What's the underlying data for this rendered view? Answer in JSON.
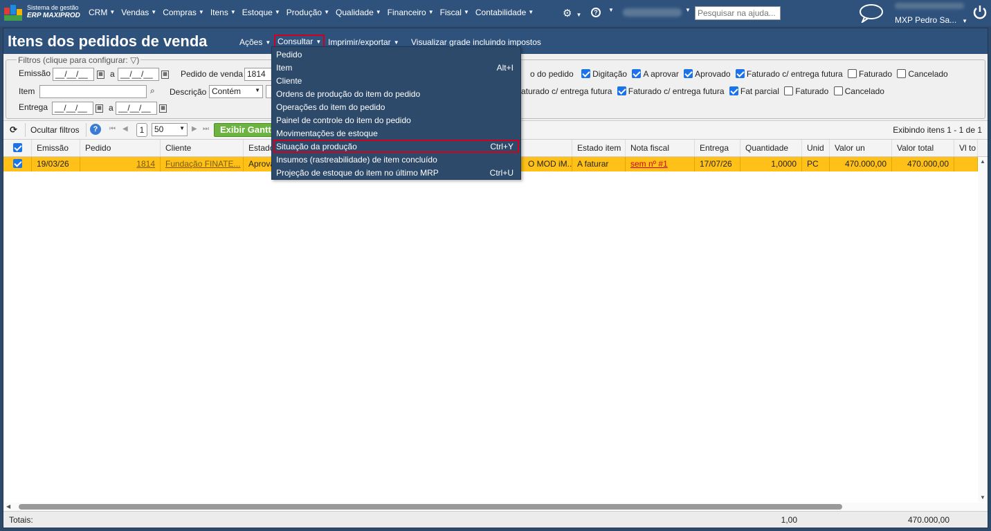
{
  "brand": {
    "line1": "Sistema de gestão",
    "line2": "ERP MAXIPROD"
  },
  "nav": [
    "CRM",
    "Vendas",
    "Compras",
    "Itens",
    "Estoque",
    "Produção",
    "Qualidade",
    "Financeiro",
    "Fiscal",
    "Contabilidade"
  ],
  "search": {
    "placeholder": "Pesquisar na ajuda..."
  },
  "user": {
    "name": "MXP Pedro Sa..."
  },
  "window": {
    "title": "Itens dos pedidos de venda",
    "menu": {
      "acoes": "Ações",
      "consultar": "Consultar",
      "imprimir": "Imprimir/exportar",
      "visualizar": "Visualizar grade incluindo impostos"
    }
  },
  "filters": {
    "legend": "Filtros (clique para configurar:",
    "legend_close": ")",
    "emissao_label": "Emissão",
    "date_placeholder": "__/__/__",
    "a_label": "a",
    "pedido_label": "Pedido de venda",
    "pedido_value": "1814",
    "item_label": "Item",
    "descricao_label": "Descrição",
    "descricao_value": "Contém",
    "entrega_label": "Entrega",
    "estado_pedido_label": "o do pedido",
    "estado_pedido": [
      {
        "label": "Digitação",
        "checked": true
      },
      {
        "label": "A aprovar",
        "checked": true
      },
      {
        "label": "Aprovado",
        "checked": true
      },
      {
        "label": "Faturado c/ entrega futura",
        "checked": true
      },
      {
        "label": "Faturado",
        "checked": false
      },
      {
        "label": "Cancelado",
        "checked": false
      }
    ],
    "estado_item_partial": "aturado c/ entrega futura",
    "estado_item": [
      {
        "label": "Faturado c/ entrega futura",
        "checked": true
      },
      {
        "label": "Fat parcial",
        "checked": true
      },
      {
        "label": "Faturado",
        "checked": false
      },
      {
        "label": "Cancelado",
        "checked": false
      }
    ]
  },
  "toolbar": {
    "ocultar": "Ocultar filtros",
    "page": "1",
    "page_size": "50",
    "gantt": "Exibir Gantt",
    "info": "Exibindo itens 1 - 1 de 1"
  },
  "grid": {
    "headers": [
      "Emissão",
      "Pedido",
      "Cliente",
      "Estado",
      "Estado item",
      "Nota fiscal",
      "Entrega",
      "Quantidade",
      "Unid",
      "Valor un",
      "Valor total",
      "Vl to"
    ],
    "row": {
      "emissao": "19/03/26",
      "pedido": "1814",
      "cliente": "Fundação FINATE...",
      "estado": "Aprova",
      "descricao": "O MOD iM...",
      "estado_item": "A faturar",
      "nota_fiscal": "sem nº #1",
      "entrega": "17/07/26",
      "quantidade": "1,0000",
      "unid": "PC",
      "valor_un": "470.000,00",
      "valor_total": "470.000,00"
    },
    "totals": {
      "label": "Totais:",
      "quantidade": "1,00",
      "valor_total": "470.000,00"
    }
  },
  "dropdown": [
    {
      "label": "Pedido",
      "shortcut": ""
    },
    {
      "label": "Item",
      "shortcut": "Alt+I"
    },
    {
      "label": "Cliente",
      "shortcut": ""
    },
    {
      "label": "Ordens de produção do item do pedido",
      "shortcut": ""
    },
    {
      "label": "Operações do item do pedido",
      "shortcut": ""
    },
    {
      "label": "Painel de controle do item do pedido",
      "shortcut": ""
    },
    {
      "label": "Movimentações de estoque",
      "shortcut": ""
    },
    {
      "label": "Situação da produção",
      "shortcut": "Ctrl+Y"
    },
    {
      "label": "Insumos (rastreabilidade) de item concluído",
      "shortcut": ""
    },
    {
      "label": "Projeção de estoque do item no último MRP",
      "shortcut": "Ctrl+U"
    }
  ],
  "colors": {
    "navbar": "#2f527d",
    "row_selected": "#ffc117",
    "highlight": "#d2001c",
    "gantt": "#6db33f"
  }
}
